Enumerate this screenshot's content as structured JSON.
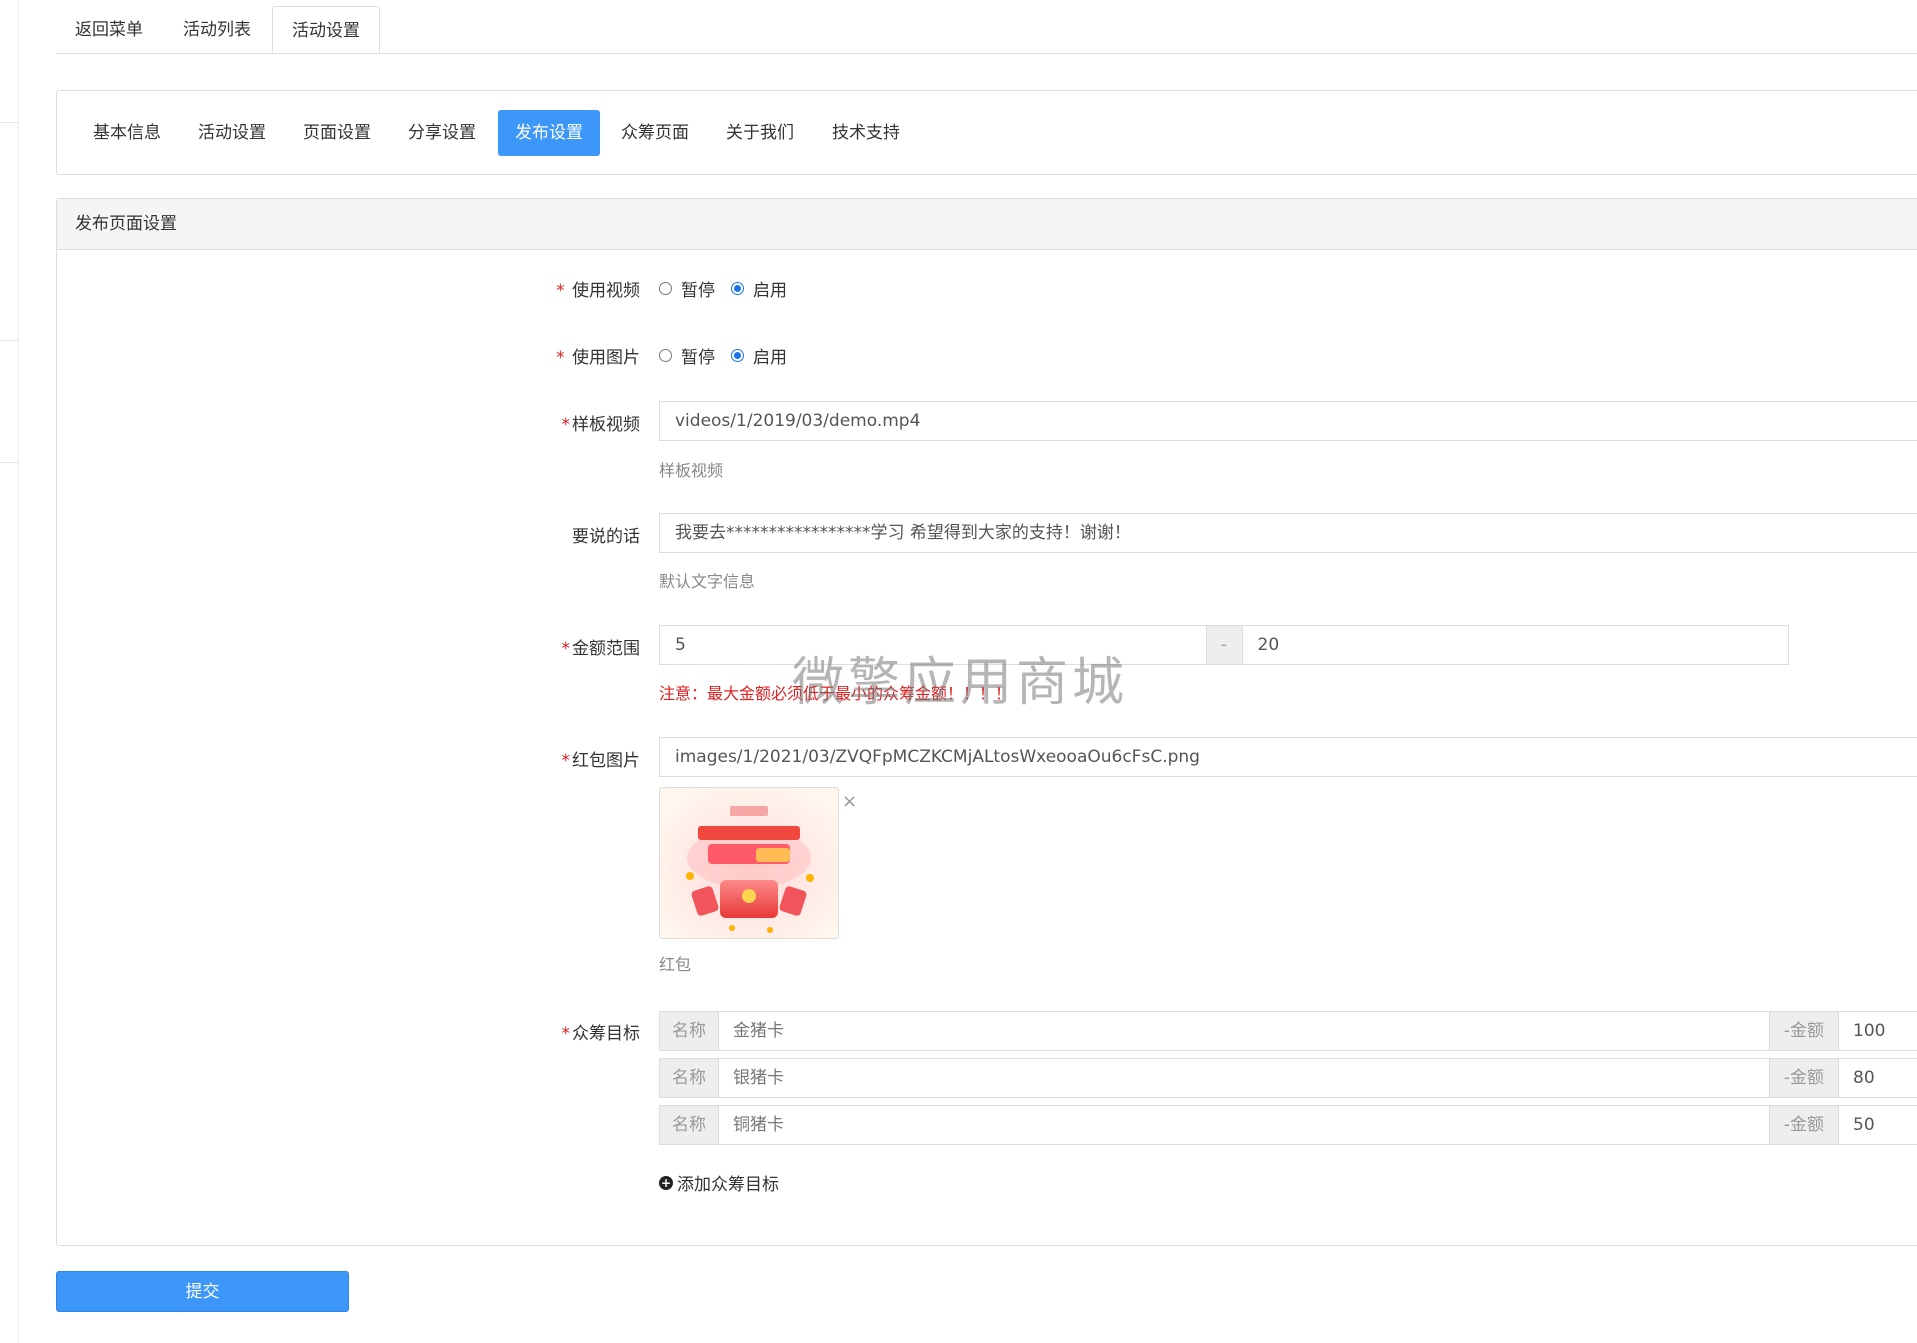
{
  "top_tabs": [
    "返回菜单",
    "活动列表",
    "活动设置"
  ],
  "sub_tabs": [
    "基本信息",
    "活动设置",
    "页面设置",
    "分享设置",
    "发布设置",
    "众筹页面",
    "关于我们",
    "技术支持"
  ],
  "active_sub_tab": "发布设置",
  "panel_title": "发布页面设置",
  "form": {
    "use_video": {
      "label": "使用视频",
      "options": [
        "暂停",
        "启用"
      ],
      "selected": "启用"
    },
    "use_image": {
      "label": "使用图片",
      "options": [
        "暂停",
        "启用"
      ],
      "selected": "启用"
    },
    "sample_video": {
      "label": "样板视频",
      "value": "videos/1/2019/03/demo.mp4",
      "help": "样板视频"
    },
    "message": {
      "label": "要说的话",
      "value": "我要去*****************学习 希望得到大家的支持！谢谢！",
      "help": "默认文字信息"
    },
    "amount_range": {
      "label": "金额范围",
      "min": "5",
      "separator": "-",
      "max": "20",
      "warning": "注意：最大金额必须低于最小的众筹金额！！！！"
    },
    "red_packet_image": {
      "label": "红包图片",
      "value": "images/1/2021/03/ZVQFpMCZKCMjALtosWxeooaOu6cFsC.png",
      "help": "红包",
      "close": "×"
    },
    "goals": {
      "label": "众筹目标",
      "name_addon": "名称",
      "amount_addon": "-金额",
      "items": [
        {
          "name": "金猪卡",
          "amount": "100"
        },
        {
          "name": "银猪卡",
          "amount": "80"
        },
        {
          "name": "铜猪卡",
          "amount": "50"
        }
      ],
      "add_label": "添加众筹目标"
    }
  },
  "submit_label": "提交",
  "watermark": "微擎应用商城"
}
